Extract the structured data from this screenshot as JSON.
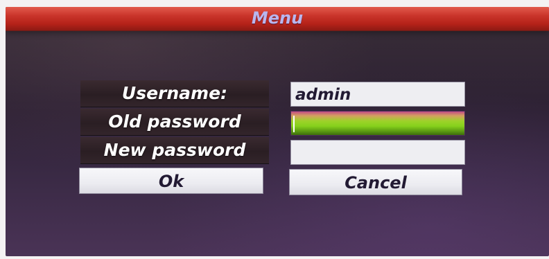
{
  "window": {
    "title": "Menu"
  },
  "form": {
    "username_label": "Username:",
    "old_password_label": "Old password",
    "new_password_label": "New password",
    "username_value": "admin",
    "old_password_value": "",
    "new_password_value": ""
  },
  "buttons": {
    "ok_label": "Ok",
    "cancel_label": "Cancel"
  },
  "colors": {
    "title_bar": "#c9342a",
    "title_text": "#b9b6ee",
    "active_field": "#86d11c",
    "background": "#2d2133"
  }
}
